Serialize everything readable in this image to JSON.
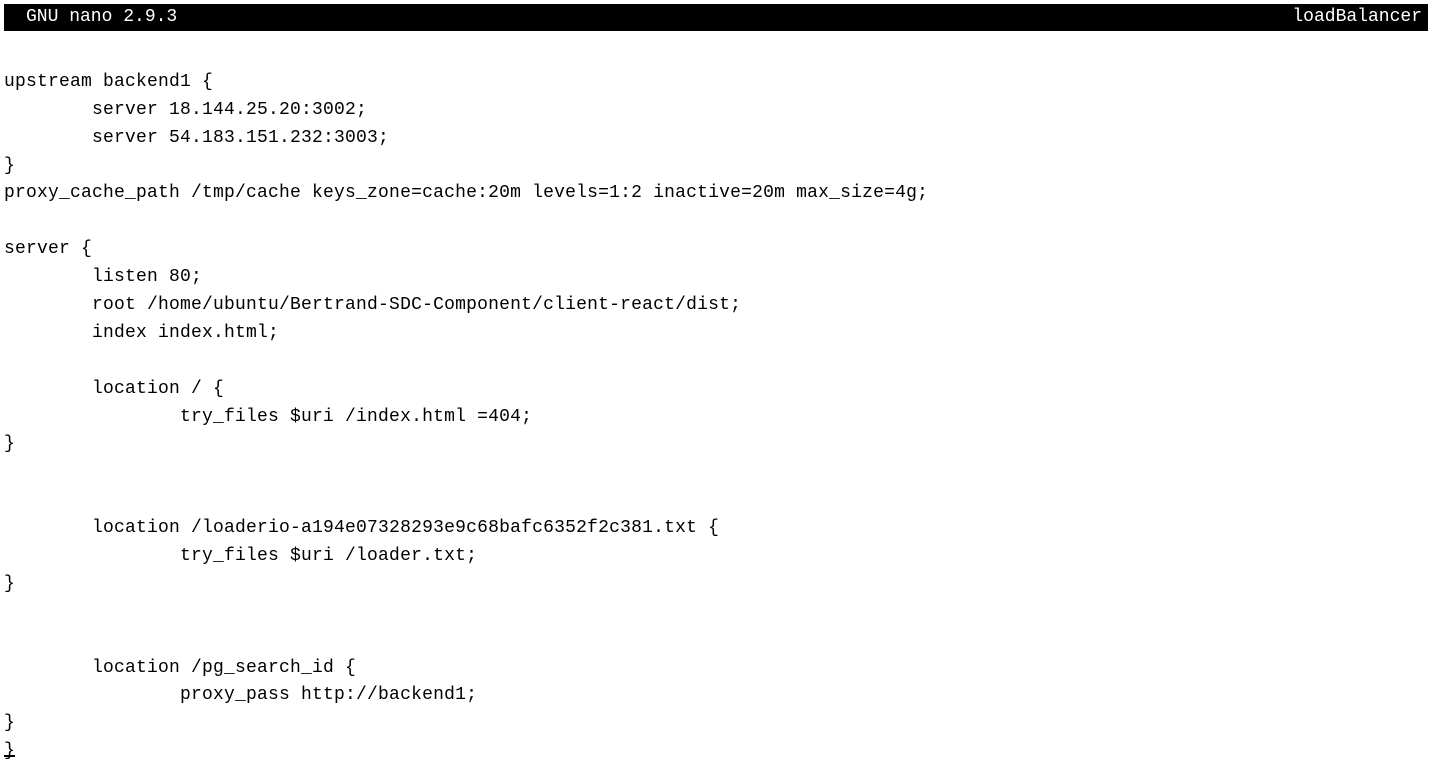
{
  "title": {
    "left": "GNU nano 2.9.3",
    "right": "loadBalancer"
  },
  "lines": [
    "",
    "upstream backend1 {",
    "        server 18.144.25.20:3002;",
    "        server 54.183.151.232:3003;",
    "}",
    "proxy_cache_path /tmp/cache keys_zone=cache:20m levels=1:2 inactive=20m max_size=4g;",
    "",
    "server {",
    "        listen 80;",
    "        root /home/ubuntu/Bertrand-SDC-Component/client-react/dist;",
    "        index index.html;",
    "",
    "        location / {",
    "                try_files $uri /index.html =404;",
    "}",
    "",
    "",
    "        location /loaderio-a194e07328293e9c68bafc6352f2c381.txt {",
    "                try_files $uri /loader.txt;",
    "}",
    "",
    "",
    "        location /pg_search_id {",
    "                proxy_pass http://backend1;",
    "}",
    "}"
  ]
}
